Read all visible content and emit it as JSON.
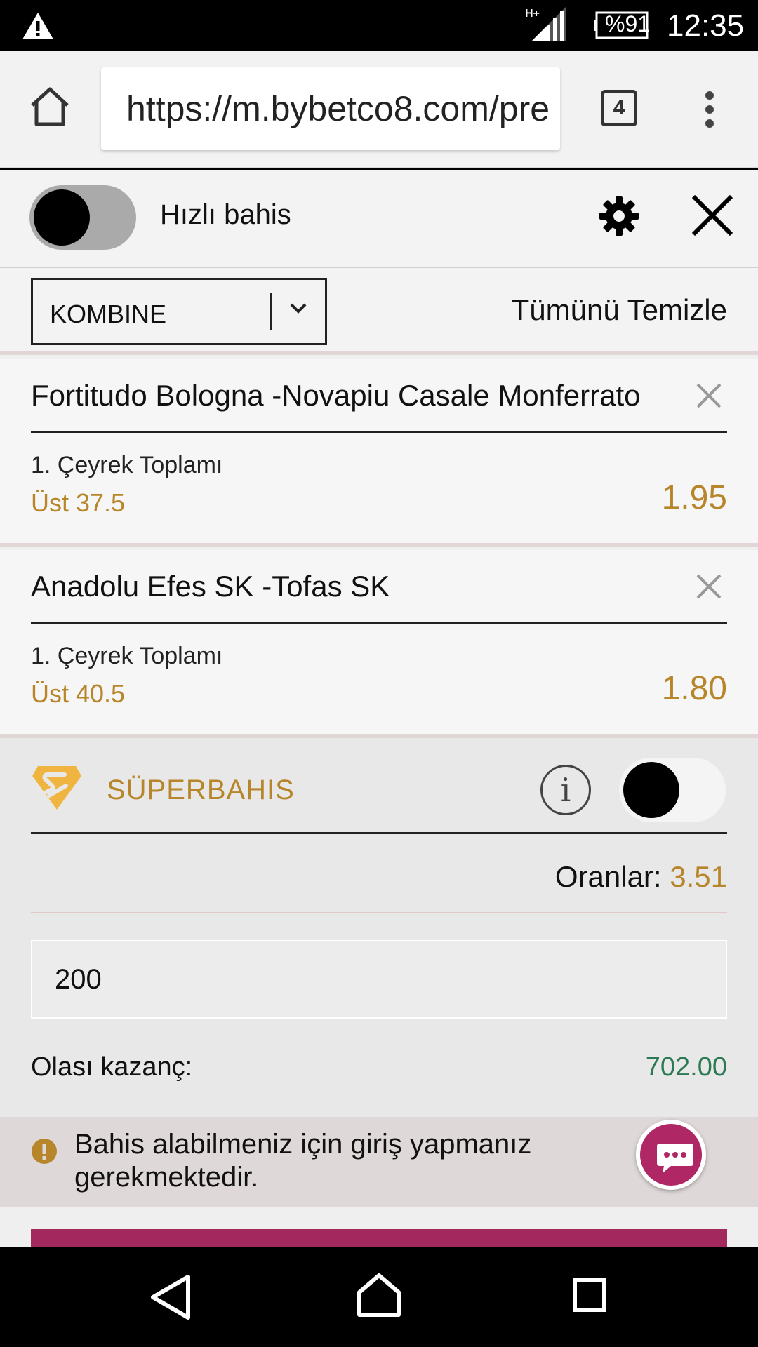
{
  "status_bar": {
    "battery": "%91",
    "time": "12:35",
    "network": "H+"
  },
  "browser": {
    "url": "https://m.bybetco8.com/pre",
    "tab_count": "4"
  },
  "quick_bet": {
    "label": "Hızlı bahis",
    "enabled": false
  },
  "bet_type": {
    "selected": "KOMBINE",
    "clear_all": "Tümünü Temizle"
  },
  "bets": [
    {
      "event": "Fortitudo Bologna -Novapiu Casale Monferrato",
      "market": "1. Çeyrek Toplamı",
      "selection": "Üst 37.5",
      "odd": "1.95"
    },
    {
      "event": "Anadolu Efes SK -Tofas SK",
      "market": "1. Çeyrek Toplamı",
      "selection": "Üst 40.5",
      "odd": "1.80"
    }
  ],
  "superbahis": {
    "label": "SÜPERBAHIS",
    "enabled": false
  },
  "odds": {
    "label": "Oranlar:",
    "value": "3.51"
  },
  "stake": {
    "value": "200"
  },
  "potential_win": {
    "label": "Olası kazanç:",
    "value": "702.00"
  },
  "alert": {
    "message": "Bahis alabilmeniz için giriş yapmanız gerekmektedir."
  },
  "colors": {
    "accent_gold": "#b8862a",
    "brand_magenta": "#a3285e",
    "win_green": "#2b7a55"
  }
}
